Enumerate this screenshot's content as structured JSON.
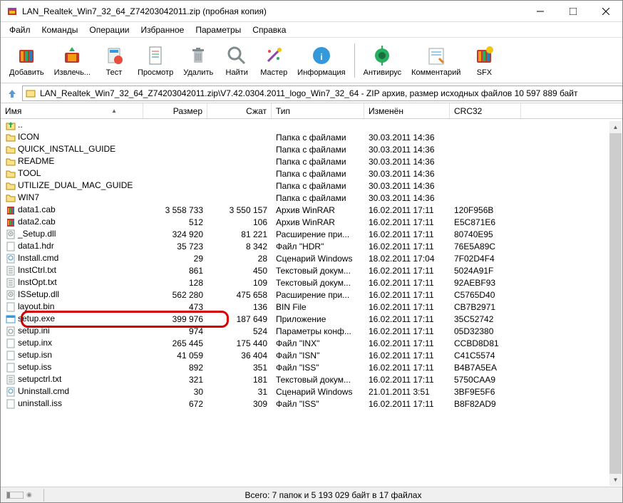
{
  "window": {
    "title": "LAN_Realtek_Win7_32_64_Z74203042011.zip (пробная копия)"
  },
  "menu": {
    "file": "Файл",
    "commands": "Команды",
    "operations": "Операции",
    "favorites": "Избранное",
    "options": "Параметры",
    "help": "Справка"
  },
  "toolbar": {
    "add": "Добавить",
    "extract": "Извлечь...",
    "test": "Тест",
    "view": "Просмотр",
    "delete": "Удалить",
    "find": "Найти",
    "wizard": "Мастер",
    "info": "Информация",
    "virus": "Антивирус",
    "comment": "Комментарий",
    "sfx": "SFX"
  },
  "address": {
    "path": "LAN_Realtek_Win7_32_64_Z74203042011.zip\\V7.42.0304.2011_logo_Win7_32_64 - ZIP архив, размер исходных файлов 10 597 889 байт"
  },
  "columns": {
    "name": "Имя",
    "size": "Размер",
    "packed": "Сжат",
    "type": "Тип",
    "modified": "Изменён",
    "crc": "CRC32"
  },
  "files": [
    {
      "icon": "up",
      "name": "..",
      "size": "",
      "packed": "",
      "type": "",
      "modified": "",
      "crc": ""
    },
    {
      "icon": "folder",
      "name": "ICON",
      "size": "",
      "packed": "",
      "type": "Папка с файлами",
      "modified": "30.03.2011 14:36",
      "crc": ""
    },
    {
      "icon": "folder",
      "name": "QUICK_INSTALL_GUIDE",
      "size": "",
      "packed": "",
      "type": "Папка с файлами",
      "modified": "30.03.2011 14:36",
      "crc": ""
    },
    {
      "icon": "folder",
      "name": "README",
      "size": "",
      "packed": "",
      "type": "Папка с файлами",
      "modified": "30.03.2011 14:36",
      "crc": ""
    },
    {
      "icon": "folder",
      "name": "TOOL",
      "size": "",
      "packed": "",
      "type": "Папка с файлами",
      "modified": "30.03.2011 14:36",
      "crc": ""
    },
    {
      "icon": "folder",
      "name": "UTILIZE_DUAL_MAC_GUIDE",
      "size": "",
      "packed": "",
      "type": "Папка с файлами",
      "modified": "30.03.2011 14:36",
      "crc": ""
    },
    {
      "icon": "folder",
      "name": "WIN7",
      "size": "",
      "packed": "",
      "type": "Папка с файлами",
      "modified": "30.03.2011 14:36",
      "crc": ""
    },
    {
      "icon": "rar",
      "name": "data1.cab",
      "size": "3 558 733",
      "packed": "3 550 157",
      "type": "Архив WinRAR",
      "modified": "16.02.2011 17:11",
      "crc": "120F956B"
    },
    {
      "icon": "rar",
      "name": "data2.cab",
      "size": "512",
      "packed": "106",
      "type": "Архив WinRAR",
      "modified": "16.02.2011 17:11",
      "crc": "E5C871E6"
    },
    {
      "icon": "dll",
      "name": "_Setup.dll",
      "size": "324 920",
      "packed": "81 221",
      "type": "Расширение при...",
      "modified": "16.02.2011 17:11",
      "crc": "80740E95"
    },
    {
      "icon": "file",
      "name": "data1.hdr",
      "size": "35 723",
      "packed": "8 342",
      "type": "Файл \"HDR\"",
      "modified": "16.02.2011 17:11",
      "crc": "76E5A89C"
    },
    {
      "icon": "cmd",
      "name": "Install.cmd",
      "size": "29",
      "packed": "28",
      "type": "Сценарий Windows",
      "modified": "18.02.2011 17:04",
      "crc": "7F02D4F4"
    },
    {
      "icon": "txt",
      "name": "InstCtrl.txt",
      "size": "861",
      "packed": "450",
      "type": "Текстовый докум...",
      "modified": "16.02.2011 17:11",
      "crc": "5024A91F"
    },
    {
      "icon": "txt",
      "name": "InstOpt.txt",
      "size": "128",
      "packed": "109",
      "type": "Текстовый докум...",
      "modified": "16.02.2011 17:11",
      "crc": "92AEBF93"
    },
    {
      "icon": "dll",
      "name": "ISSetup.dll",
      "size": "562 280",
      "packed": "475 658",
      "type": "Расширение при...",
      "modified": "16.02.2011 17:11",
      "crc": "C5765D40"
    },
    {
      "icon": "file",
      "name": "layout.bin",
      "size": "473",
      "packed": "136",
      "type": "BIN File",
      "modified": "16.02.2011 17:11",
      "crc": "CB7B2971"
    },
    {
      "icon": "exe",
      "name": "setup.exe",
      "size": "399 976",
      "packed": "187 649",
      "type": "Приложение",
      "modified": "16.02.2011 17:11",
      "crc": "35C52742",
      "highlight": true
    },
    {
      "icon": "ini",
      "name": "setup.ini",
      "size": "974",
      "packed": "524",
      "type": "Параметры конф...",
      "modified": "16.02.2011 17:11",
      "crc": "05D32380"
    },
    {
      "icon": "file",
      "name": "setup.inx",
      "size": "265 445",
      "packed": "175 440",
      "type": "Файл \"INX\"",
      "modified": "16.02.2011 17:11",
      "crc": "CCBD8D81"
    },
    {
      "icon": "file",
      "name": "setup.isn",
      "size": "41 059",
      "packed": "36 404",
      "type": "Файл \"ISN\"",
      "modified": "16.02.2011 17:11",
      "crc": "C41C5574"
    },
    {
      "icon": "file",
      "name": "setup.iss",
      "size": "892",
      "packed": "351",
      "type": "Файл \"ISS\"",
      "modified": "16.02.2011 17:11",
      "crc": "B4B7A5EA"
    },
    {
      "icon": "txt",
      "name": "setupctrl.txt",
      "size": "321",
      "packed": "181",
      "type": "Текстовый докум...",
      "modified": "16.02.2011 17:11",
      "crc": "5750CAA9"
    },
    {
      "icon": "cmd",
      "name": "Uninstall.cmd",
      "size": "30",
      "packed": "31",
      "type": "Сценарий Windows",
      "modified": "21.01.2011 3:51",
      "crc": "3BF9E5F6"
    },
    {
      "icon": "file",
      "name": "uninstall.iss",
      "size": "672",
      "packed": "309",
      "type": "Файл \"ISS\"",
      "modified": "16.02.2011 17:11",
      "crc": "B8F82AD9"
    }
  ],
  "statusbar": {
    "text": "Всего: 7 папок и 5 193 029 байт в 17 файлах"
  }
}
